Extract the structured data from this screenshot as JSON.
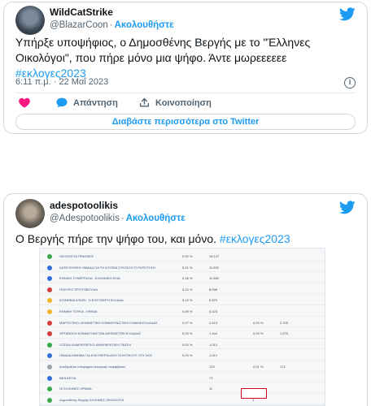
{
  "tweet1": {
    "display_name": "WildCatStrike",
    "handle": "@BlazarCoon",
    "follow_label": "Ακολουθήστε",
    "text": "Υπήρξε υποψήφιος, ο Δημοσθένης Βεργής με το \"Έλληνες Οικολόγοι\", που πήρε μόνο μια ψήφο. Άντε μωρεεεεεε",
    "hashtag": "#εκλογες2023",
    "timestamp": "6:11 π.μ. · 22 Μαΐ 2023",
    "reply_label": "Απάντηση",
    "share_label": "Κοινοποίηση",
    "read_more_label": "Διαβάστε περισσότερα στο Twitter"
  },
  "tweet2": {
    "display_name": "adespotoolikis",
    "handle": "@Adespotoolikis",
    "follow_label": "Ακολουθήστε",
    "text": "Ο Βεργής πήρε την ψήφο του, και μόνο.",
    "hashtag": "#εκλογες2023"
  },
  "results_image": {
    "rows": [
      {
        "name": "ΟΙΚΟΛΟΓΟΙ ΠΡΑΣΙΝΟΙ",
        "pct": "0,32 %",
        "votes": "18.137",
        "c3": "",
        "c4": "",
        "color": "#3aa84b"
      },
      {
        "name": "ΚΑΤΕΥΘΥΝΣΗ ΟΜΑΔΑ ΓΙΑ ΤΗ ΝΤΟΠΙΑ ΣΥΝΤΑΞΗ ΣΥΓΚΡΟΤΗΣΗ",
        "pct": "0,21 %",
        "votes": "11.592",
        "c3": "",
        "c4": "",
        "color": "#2e6fd8"
      },
      {
        "name": "ΕΘΝΙΚΗ ΣΥΝΕΡΓΑΣΙΑ - ΕΛΛΗΝΙΚΗ ΕΛΙΑ",
        "pct": "0,18 %",
        "votes": "11.582",
        "c3": "",
        "c4": "",
        "color": "#2e6fd8"
      },
      {
        "name": "ΠΟΛΙΤΕΣ ΠΡΟΤΟΒΟΥΛΙΑ",
        "pct": "0,13 %",
        "votes": "8.096",
        "c3": "",
        "c4": "",
        "color": "#d63b3b"
      },
      {
        "name": "ΚΟΙΝΩΝΙΑ ΑΞΙΩΝ - Η ΕΛΕΥΘΕΡΗ ΕΛΛΑΔΑ",
        "pct": "0,13 %",
        "votes": "5.870",
        "c3": "",
        "c4": "",
        "color": "#f0b429"
      },
      {
        "name": "ΕΘΝΙΚΗ ΤΟΥΚΑ - ΚΡΑΝΑ",
        "pct": "0,09 %",
        "votes": "5.423",
        "c3": "",
        "c4": "",
        "color": "#f0b429"
      },
      {
        "name": "ΜΑΡΞΙΣΤΙΚΟ-ΛΕΝΙΝΙΣΤΙΚΟ ΚΟΜΜΟΥΝΙΣΤΙΚΟ ΚΟΜΜΑ ΕΛΛΑΔΑΣ",
        "pct": "0,07 %",
        "votes": "2.413",
        "c3": "0,03 %",
        "c4": "2.705",
        "color": "#d63b3b"
      },
      {
        "name": "ΟΡΓΑΝΩΣΗ ΚΟΜΜΟΥΝΙΣΤΩΝ ΔΙΕΘΝΙΣΤΩΝ ΕΛΛΑΔΑΣ",
        "pct": "0,03 %",
        "votes": "1.444",
        "c3": "0,03 %",
        "c4": "1.575",
        "color": "#d63b3b"
      },
      {
        "name": "ΣΟΣΙΑΛ ΔΗΜΟΚΡΑΤΙΚΟ ΔΗΜΟΚΡΑΤΙΚΗ ΓΝΩΣΗ",
        "pct": "0,03 %",
        "votes": "1.013",
        "c3": "",
        "c4": "",
        "color": "#3aa84b"
      },
      {
        "name": "ΟΜΑΔΑ ΚΙΝΗΜΑ ΓΙΑ ΕΛΕΥΘΕΡΙΑ ΑΠΟ ΠΟΛΙΤΙΚΟΥΣ ΤΟΥ ΝΟΣ",
        "pct": "0,03 %",
        "votes": "1.012",
        "c3": "",
        "c4": "",
        "color": "#2e6fd8"
      },
      {
        "name": "Ανεξάρτητοι υποψήφιοι εκλογικής περιφέρειας",
        "pct": "",
        "votes": "133",
        "c3": "0,01 %",
        "c4": "172",
        "color": "#9aa3ad"
      },
      {
        "name": "ΝΕΑ ΔΕΞΙΑ",
        "pct": "",
        "votes": "73",
        "c3": "",
        "c4": "",
        "color": "#2e6fd8"
      },
      {
        "name": "ΟΙ ΕΛΛΗΝΕΣ ΟΡΑΜΑ",
        "pct": "",
        "votes": "11",
        "c3": "",
        "c4": "",
        "color": "#3aa84b"
      },
      {
        "name": "Δημοσθένης Βεργής ΕΛΛΗΝΕΣ ΟΙΚΟΛΟΓΟΙ",
        "pct": "",
        "votes": "1",
        "c3": "",
        "c4": "",
        "color": "#3aa84b"
      }
    ]
  },
  "colors": {
    "accent": "#1d9bf0",
    "like": "#f91880",
    "highlight": "#d0021b"
  }
}
